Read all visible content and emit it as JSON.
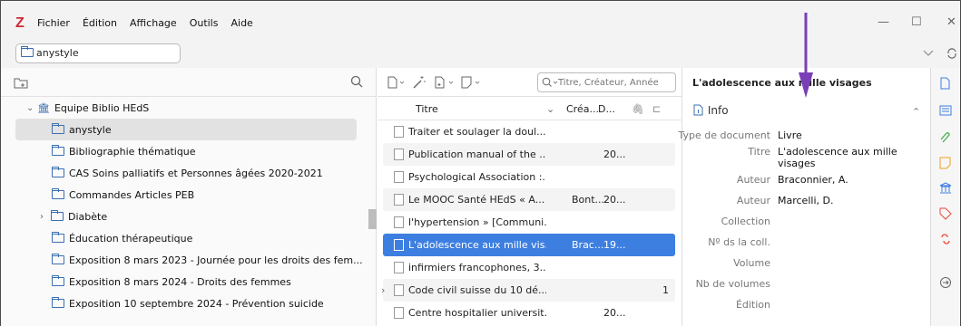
{
  "menu": [
    "Fichier",
    "Édition",
    "Affichage",
    "Outils",
    "Aide"
  ],
  "logo": "Z",
  "window": {
    "minimize": "—",
    "maximize": "☐",
    "close": "✕"
  },
  "library_field": "anystyle",
  "collections": {
    "root": "Equipe Biblio HEdS",
    "items": [
      {
        "label": "anystyle",
        "selected": true,
        "expandable": false
      },
      {
        "label": "Bibliographie thématique",
        "selected": false,
        "expandable": false
      },
      {
        "label": "CAS Soins palliatifs et Personnes âgées 2020-2021",
        "selected": false,
        "expandable": false
      },
      {
        "label": "Commandes Articles PEB",
        "selected": false,
        "expandable": false
      },
      {
        "label": "Diabète",
        "selected": false,
        "expandable": true
      },
      {
        "label": "Éducation thérapeutique",
        "selected": false,
        "expandable": false
      },
      {
        "label": "Exposition 8 mars 2023 - Journée pour les droits des fem...",
        "selected": false,
        "expandable": false
      },
      {
        "label": "Exposition 8 mars 2024 - Droits des femmes",
        "selected": false,
        "expandable": false
      },
      {
        "label": "Exposition 10 septembre 2024 - Prévention suicide",
        "selected": false,
        "expandable": false
      }
    ]
  },
  "items_toolbar": {
    "search_placeholder": "Titre, Créateur, Année"
  },
  "columns": {
    "title": "Titre",
    "creator": "Créa...",
    "date": "D..."
  },
  "items": [
    {
      "title": "Traiter et soulager la doul...",
      "creator": "",
      "date": "",
      "n": ""
    },
    {
      "title": "Publication manual of the ...",
      "creator": "",
      "date": "20...",
      "n": ""
    },
    {
      "title": "Psychological Association :...",
      "creator": "",
      "date": "",
      "n": ""
    },
    {
      "title": "Le MOOC Santé HEdS « A...",
      "creator": "Bont...",
      "date": "20...",
      "n": ""
    },
    {
      "title": "l'hypertension » [Communi...",
      "creator": "",
      "date": "",
      "n": ""
    },
    {
      "title": "L'adolescence aux mille vis...",
      "creator": "Brac...",
      "date": "19...",
      "n": "",
      "selected": true
    },
    {
      "title": "infirmiers francophones, 3...",
      "creator": "",
      "date": "",
      "n": ""
    },
    {
      "title": "Code civil suisse du 10 dé...",
      "creator": "",
      "date": "",
      "n": "1",
      "expandable": true
    },
    {
      "title": "Centre hospitalier universit...",
      "creator": "",
      "date": "20...",
      "n": ""
    }
  ],
  "item_pane": {
    "header": "L'adolescence aux mille visages",
    "section": "Info",
    "fields": [
      {
        "label": "Type de document",
        "value": "Livre"
      },
      {
        "label": "Titre",
        "value": "L'adolescence aux mille visages"
      },
      {
        "label": "Auteur",
        "value": "Braconnier, A."
      },
      {
        "label": "Auteur",
        "value": "Marcelli, D."
      },
      {
        "label": "Collection",
        "value": ""
      },
      {
        "label": "Nº ds la coll.",
        "value": ""
      },
      {
        "label": "Volume",
        "value": ""
      },
      {
        "label": "Nb de volumes",
        "value": ""
      },
      {
        "label": "Édition",
        "value": ""
      }
    ]
  },
  "colors": {
    "accent": "#3d7fe0",
    "logo": "#cc2936",
    "arrow": "#7a3fb6"
  }
}
